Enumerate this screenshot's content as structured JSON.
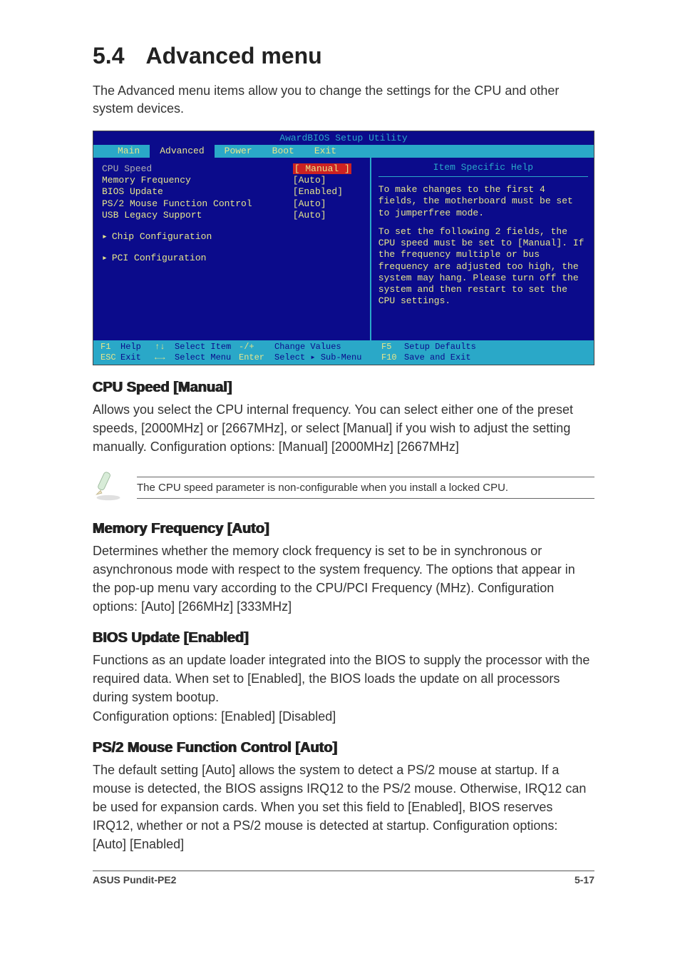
{
  "heading": {
    "num": "5.4",
    "title": "Advanced menu"
  },
  "intro": "The Advanced menu items allow you to change the settings for the CPU and other system devices.",
  "bios": {
    "title": "AwardBIOS Setup Utility",
    "tabs": [
      "Main",
      "Advanced",
      "Power",
      "Boot",
      "Exit"
    ],
    "active_tab": "Advanced",
    "left": {
      "header": "CPU Speed",
      "rows": [
        {
          "k": "Memory Frequency",
          "v": "[Auto]"
        },
        {
          "k": "BIOS Update",
          "v": "[Enabled]"
        },
        {
          "k": "PS/2 Mouse Function Control",
          "v": "[Auto]"
        },
        {
          "k": "USB Legacy Support",
          "v": "[Auto]"
        }
      ],
      "selected_value": "[ Manual ]",
      "subs": [
        "Chip Configuration",
        "PCI Configuration"
      ]
    },
    "help": {
      "title": "Item Specific Help",
      "p1": "To make changes to the first 4 fields, the motherboard must be set to jumperfree mode.",
      "p2": "To set the following 2 fields, the CPU speed must be set to [Manual]. If the frequency multiple or bus frequency are adjusted too high, the system may hang. Please turn off the system and then restart to set the CPU settings."
    },
    "footer": {
      "c": [
        [
          "F1",
          "Help",
          "↑↓",
          "Select Item",
          "-/+",
          "Change Values",
          "F5",
          "Setup Defaults"
        ],
        [
          "ESC",
          "Exit",
          "←→",
          "Select Menu",
          "Enter",
          "Select ▸ Sub-Menu",
          "F10",
          "Save and Exit"
        ]
      ]
    }
  },
  "sections": [
    {
      "head": "CPU Speed [Manual]",
      "body": "Allows you select the CPU internal frequency. You can select either one of the preset speeds, [2000MHz] or [2667MHz], or select [Manual] if you wish to adjust the setting manually. Configuration options: [Manual] [2000MHz] [2667MHz]"
    }
  ],
  "note": "The CPU speed parameter is non-configurable when you install a locked CPU.",
  "sections2": [
    {
      "head": "Memory Frequency [Auto]",
      "body": "Determines whether the memory clock frequency is set to be in synchronous or asynchronous mode with respect to the system frequency. The options that appear in the pop-up menu vary according to the CPU/PCI Frequency (MHz). Configuration options: [Auto] [266MHz] [333MHz]"
    },
    {
      "head": "BIOS Update [Enabled]",
      "body": "Functions as an update loader integrated into the BIOS to supply the processor with the required data. When set to [Enabled], the BIOS loads the update on all processors during system bootup.\nConfiguration options: [Enabled] [Disabled]"
    },
    {
      "head": "PS/2 Mouse Function Control [Auto]",
      "body": "The default setting [Auto] allows the system to detect a PS/2 mouse at startup. If a mouse is detected, the BIOS assigns IRQ12 to the PS/2 mouse. Otherwise, IRQ12 can be used for expansion cards. When you set this field to [Enabled], BIOS reserves IRQ12, whether or not a PS/2 mouse is detected at startup. Configuration options: [Auto] [Enabled]"
    }
  ],
  "footer": {
    "left": "ASUS Pundit-PE2",
    "right": "5-17"
  }
}
